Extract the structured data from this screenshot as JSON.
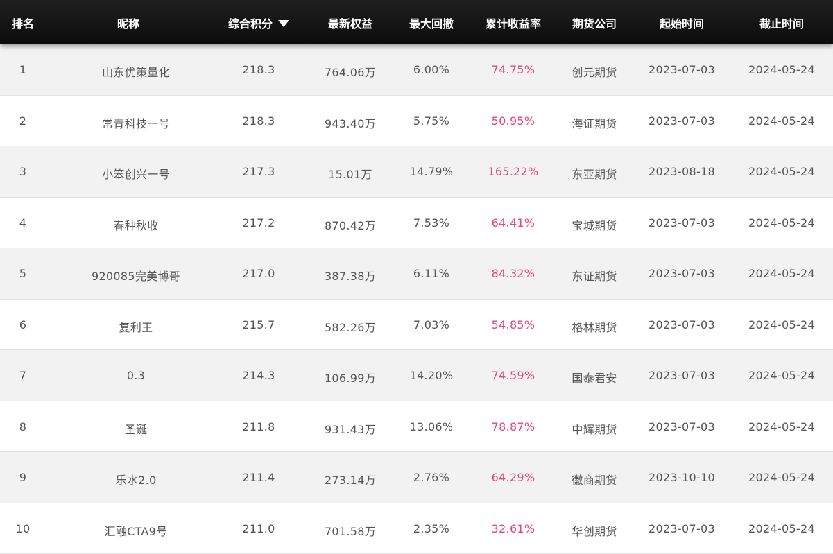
{
  "headers": {
    "rank": "排名",
    "nickname": "昵称",
    "score": "综合积分",
    "equity": "最新权益",
    "drawdown": "最大回撤",
    "return": "累计收益率",
    "broker": "期货公司",
    "start": "起始时间",
    "end": "截止时间"
  },
  "sort_icon": "triangle-down-icon",
  "colors": {
    "header_bg": "#111111",
    "row_alt_bg": "#f2f2f2",
    "return_text": "#e8457a",
    "body_text": "#555555"
  },
  "rows": [
    {
      "rank": "1",
      "nickname": "山东优策量化",
      "score": "218.3",
      "equity": "764.06万",
      "drawdown": "6.00%",
      "return": "74.75%",
      "broker": "创元期货",
      "start": "2023-07-03",
      "end": "2024-05-24"
    },
    {
      "rank": "2",
      "nickname": "常青科技一号",
      "score": "218.3",
      "equity": "943.40万",
      "drawdown": "5.75%",
      "return": "50.95%",
      "broker": "海证期货",
      "start": "2023-07-03",
      "end": "2024-05-24"
    },
    {
      "rank": "3",
      "nickname": "小笨创兴一号",
      "score": "217.3",
      "equity": "15.01万",
      "drawdown": "14.79%",
      "return": "165.22%",
      "broker": "东亚期货",
      "start": "2023-08-18",
      "end": "2024-05-24"
    },
    {
      "rank": "4",
      "nickname": "春种秋收",
      "score": "217.2",
      "equity": "870.42万",
      "drawdown": "7.53%",
      "return": "64.41%",
      "broker": "宝城期货",
      "start": "2023-07-03",
      "end": "2024-05-24"
    },
    {
      "rank": "5",
      "nickname": "920085完美博哥",
      "score": "217.0",
      "equity": "387.38万",
      "drawdown": "6.11%",
      "return": "84.32%",
      "broker": "东证期货",
      "start": "2023-07-03",
      "end": "2024-05-24"
    },
    {
      "rank": "6",
      "nickname": "复利王",
      "score": "215.7",
      "equity": "582.26万",
      "drawdown": "7.03%",
      "return": "54.85%",
      "broker": "格林期货",
      "start": "2023-07-03",
      "end": "2024-05-24"
    },
    {
      "rank": "7",
      "nickname": "0.3",
      "score": "214.3",
      "equity": "106.99万",
      "drawdown": "14.20%",
      "return": "74.59%",
      "broker": "国泰君安",
      "start": "2023-07-03",
      "end": "2024-05-24"
    },
    {
      "rank": "8",
      "nickname": "圣诞",
      "score": "211.8",
      "equity": "931.43万",
      "drawdown": "13.06%",
      "return": "78.87%",
      "broker": "中辉期货",
      "start": "2023-07-03",
      "end": "2024-05-24"
    },
    {
      "rank": "9",
      "nickname": "乐水2.0",
      "score": "211.4",
      "equity": "273.14万",
      "drawdown": "2.76%",
      "return": "64.29%",
      "broker": "徽商期货",
      "start": "2023-10-10",
      "end": "2024-05-24"
    },
    {
      "rank": "10",
      "nickname": "汇融CTA9号",
      "score": "211.0",
      "equity": "701.58万",
      "drawdown": "2.35%",
      "return": "32.61%",
      "broker": "华创期货",
      "start": "2023-07-03",
      "end": "2024-05-24"
    }
  ]
}
